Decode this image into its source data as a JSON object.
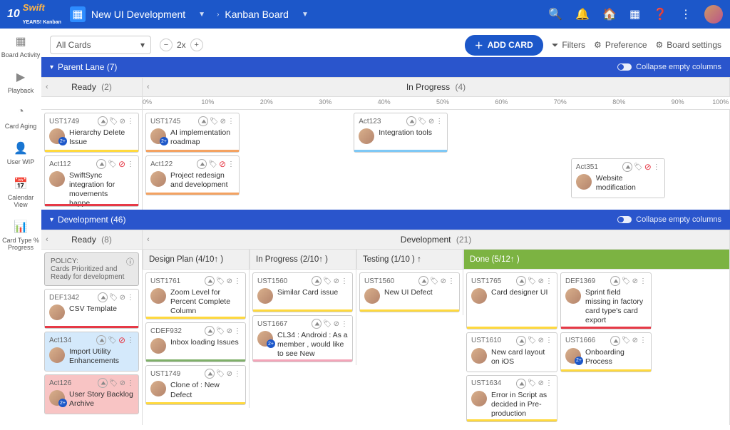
{
  "nav": {
    "logo_main": "Swift",
    "logo_ten": "10",
    "logo_sub1": "YEARS!",
    "logo_sub2": "Kanban",
    "board_name": "New UI Development",
    "breadcrumb": "Kanban Board"
  },
  "toolbar": {
    "filter_label": "All Cards",
    "zoom": "2x",
    "add_card": "ADD CARD",
    "filters": "Filters",
    "preference": "Preference",
    "board_settings": "Board settings"
  },
  "sidebar": {
    "items": [
      {
        "icon": "▦",
        "label": "Board Activity"
      },
      {
        "icon": "▶",
        "label": "Playback"
      },
      {
        "icon": "◔",
        "label": "Card Aging"
      },
      {
        "icon": "👤",
        "label": "User WIP"
      },
      {
        "icon": "📅",
        "label": "Calendar View"
      },
      {
        "icon": "📊",
        "label": "Card Type % Progress"
      }
    ]
  },
  "lanes": {
    "parent": {
      "title": "Parent Lane",
      "count": "(7)",
      "collapse_label": "Collapse empty columns",
      "columns": {
        "ready": {
          "label": "Ready",
          "count": "(2)"
        },
        "inprogress": {
          "label": "In Progress",
          "count": "(4)"
        }
      },
      "ruler": [
        "0%",
        "10%",
        "20%",
        "30%",
        "40%",
        "50%",
        "60%",
        "70%",
        "80%",
        "90%",
        "100%"
      ]
    },
    "development": {
      "title": "Development",
      "count": "(46)",
      "collapse_label": "Collapse empty columns",
      "columns": {
        "ready": {
          "label": "Ready",
          "count": "(8)"
        },
        "dev": {
          "label": "Development",
          "count": "(21)"
        }
      },
      "subcolumns": {
        "design": "Design Plan (4/10↑ )",
        "inprog": "In Progress  (2/10↑ )",
        "testing": "Testing  (1/10   ) ↑",
        "done": "Done   (5/12↑ )"
      },
      "policy": {
        "title": "POLICY:",
        "text": "Cards Prioritized and Ready for development"
      }
    }
  },
  "cards": {
    "p_ready": [
      {
        "id": "UST1749",
        "title": "Hierarchy Delete Issue",
        "bar": "bar-yellow",
        "badge": true
      },
      {
        "id": "Act112",
        "title": "SwiftSync integration for movements happe...",
        "bar": "bar-red",
        "badge": false,
        "blocked": true
      }
    ],
    "p_inprog_left": [
      {
        "id": "UST1745",
        "title": "AI implementation roadmap",
        "bar": "bar-orange",
        "badge": true
      },
      {
        "id": "Act122",
        "title": "Project redesign and development",
        "bar": "bar-orange",
        "badge": false,
        "blocked": true
      }
    ],
    "p_inprog_mid": [
      {
        "id": "Act123",
        "title": "Integration tools",
        "bar": "bar-blue"
      }
    ],
    "p_inprog_right": [
      {
        "id": "Act351",
        "title": "Website modification",
        "bar": "",
        "blocked": true
      }
    ],
    "d_ready": [
      {
        "id": "DEF1342",
        "title": "CSV Template",
        "bar": "bar-red"
      },
      {
        "id": "Act134",
        "title": "Import Utility Enhancements",
        "bar": "",
        "tint": "tint-blue",
        "blocked": true
      },
      {
        "id": "Act126",
        "title": "User Story Backlog Archive",
        "bar": "",
        "tint": "tint-red",
        "badge": true
      }
    ],
    "d_design": [
      {
        "id": "UST1761",
        "title": "Zoom Level for Percent Complete Column",
        "bar": "bar-yellow"
      },
      {
        "id": "CDEF932",
        "title": "Inbox loading Issues",
        "bar": "bar-green"
      },
      {
        "id": "UST1749",
        "title": "Clone of : New Defect",
        "bar": "bar-yellow"
      }
    ],
    "d_inprog": [
      {
        "id": "UST1560",
        "title": "Similar Card issue",
        "bar": "bar-yellow"
      },
      {
        "id": "UST1667",
        "title": "CL34 : Android : As a member , would like to see New",
        "bar": "bar-pink",
        "badge": true
      }
    ],
    "d_testing": [
      {
        "id": "UST1560",
        "title": "New UI Defect",
        "bar": "bar-yellow"
      }
    ],
    "d_done": [
      {
        "id": "UST1765",
        "title": "Card designer UI",
        "bar": "bar-yellow"
      },
      {
        "id": "DEF1369",
        "title": "Sprint field missing in factory card type's card export",
        "bar": "bar-red"
      },
      {
        "id": "UST1610",
        "title": "New card layout on iOS",
        "bar": ""
      },
      {
        "id": "UST1666",
        "title": "Onboarding Process",
        "bar": "bar-yellow",
        "badge": true
      },
      {
        "id": "UST1634",
        "title": "Error in Script as decided in Pre-production",
        "bar": "bar-yellow"
      }
    ]
  }
}
